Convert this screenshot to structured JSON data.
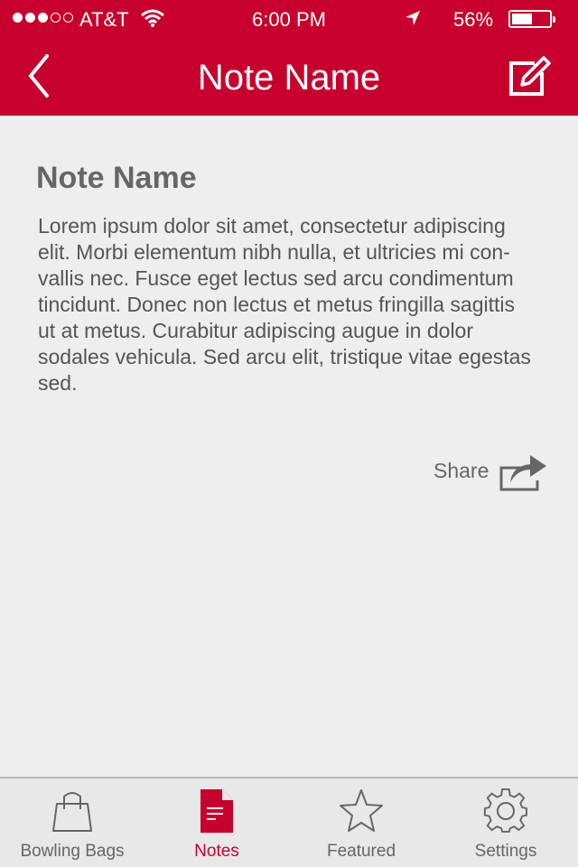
{
  "status": {
    "carrier": "AT&T",
    "time": "6:00 PM",
    "battery": "56%",
    "battery_level": 0.56
  },
  "nav": {
    "title": "Note Name"
  },
  "note": {
    "title": "Note Name",
    "body": "Lorem ipsum dolor sit amet, consectetur adipiscing\nelit. Morbi elementum nibh nulla, et ultricies mi con-\nvallis nec. Fusce eget lectus sed arcu condimentum\ntincidunt. Donec non lectus et metus fringilla sagittis\nut at metus. Curabitur adipiscing augue in dolor\nsodales vehicula. Sed arcu elit, tristique vitae egestas\nsed.",
    "share_label": "Share"
  },
  "tabs": [
    {
      "label": "Bowling Bags",
      "icon": "bag-icon",
      "active": false
    },
    {
      "label": "Notes",
      "icon": "document-icon",
      "active": true
    },
    {
      "label": "Featured",
      "icon": "star-icon",
      "active": false
    },
    {
      "label": "Settings",
      "icon": "gear-icon",
      "active": false
    }
  ],
  "colors": {
    "brand": "#c8002d",
    "background": "#eeeeee",
    "text": "#555555",
    "tab_inactive": "#666666"
  }
}
